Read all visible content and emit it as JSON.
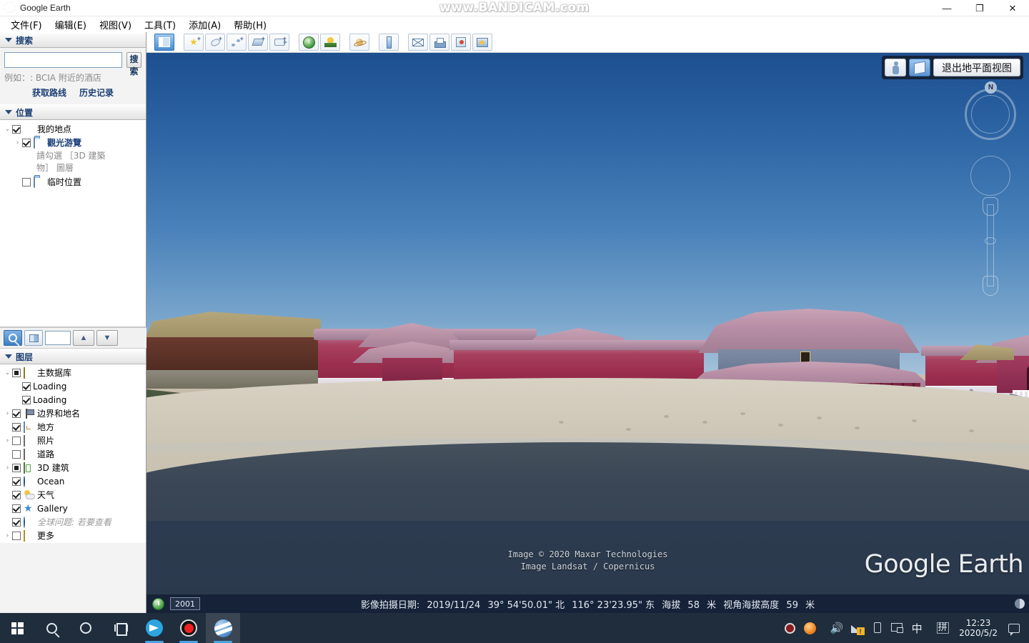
{
  "window": {
    "app_icon": "google-earth-globe-icon",
    "title": "Google Earth",
    "watermark": "www.BANDICAM.com",
    "minimize": "—",
    "maximize": "❐",
    "close": "✕"
  },
  "menubar": [
    {
      "label": "文件(F)",
      "name": "menu-file"
    },
    {
      "label": "编辑(E)",
      "name": "menu-edit"
    },
    {
      "label": "视图(V)",
      "name": "menu-view"
    },
    {
      "label": "工具(T)",
      "name": "menu-tools"
    },
    {
      "label": "添加(A)",
      "name": "menu-add"
    },
    {
      "label": "帮助(H)",
      "name": "menu-help"
    }
  ],
  "search_panel": {
    "header": "搜索",
    "input_value": "",
    "input_placeholder": "",
    "button": "搜索",
    "hint": "例如：: BCIA 附近的酒店",
    "links": [
      {
        "label": "获取路线",
        "name": "get-directions-link"
      },
      {
        "label": "历史记录",
        "name": "history-link"
      }
    ]
  },
  "places_panel": {
    "header": "位置",
    "items": [
      {
        "label": "我的地点",
        "checked": true,
        "icon": "globe-icon",
        "indent": 0,
        "expander": "v",
        "style": "normal"
      },
      {
        "label": "觀光游覽",
        "checked": true,
        "icon": "folder-icon",
        "indent": 1,
        "expander": ">",
        "style": "blue"
      },
      {
        "label": "請勾選 ［3D 建築物］ 圖層",
        "sub": true
      },
      {
        "label": "临时位置",
        "checked": false,
        "icon": "folder-icon",
        "indent": 0,
        "expander": "",
        "style": "normal"
      }
    ]
  },
  "places_toolstrip": {
    "search_icon": "magnifier-icon",
    "view_icon": "split-view-icon",
    "field_value": "",
    "up": "▲",
    "down": "▼"
  },
  "layers_panel": {
    "header": "图层",
    "items": [
      {
        "label": "主数据库",
        "state": "partial",
        "icon": "database-icon",
        "indent": 0,
        "expander": "v",
        "style": "normal"
      },
      {
        "label": "Loading",
        "state": "checked",
        "icon": "none",
        "indent": 1,
        "expander": "",
        "style": "normal"
      },
      {
        "label": "Loading",
        "state": "checked",
        "icon": "none",
        "indent": 1,
        "expander": "",
        "style": "normal"
      },
      {
        "label": "边界和地名",
        "state": "checked",
        "icon": "flag-icon",
        "indent": 1,
        "expander": ">",
        "style": "normal"
      },
      {
        "label": "地方",
        "state": "checked",
        "icon": "place-icon",
        "indent": 1,
        "expander": "",
        "style": "normal"
      },
      {
        "label": "照片",
        "state": "unchecked",
        "icon": "photo-icon",
        "indent": 1,
        "expander": ">",
        "style": "normal"
      },
      {
        "label": "道路",
        "state": "unchecked",
        "icon": "road-icon",
        "indent": 1,
        "expander": "",
        "style": "normal"
      },
      {
        "label": "3D 建筑",
        "state": "partial",
        "icon": "3d-building-icon",
        "indent": 1,
        "expander": ">",
        "style": "normal"
      },
      {
        "label": "Ocean",
        "state": "checked",
        "icon": "ocean-icon",
        "indent": 1,
        "expander": "",
        "style": "normal"
      },
      {
        "label": "天气",
        "state": "checked",
        "icon": "weather-icon",
        "indent": 1,
        "expander": "",
        "style": "normal"
      },
      {
        "label": "Gallery",
        "state": "checked",
        "icon": "star-icon",
        "indent": 1,
        "expander": "",
        "style": "normal"
      },
      {
        "label": "全球问题: 若要查看",
        "state": "checked",
        "icon": "earth-icon",
        "indent": 1,
        "expander": "",
        "style": "gray"
      },
      {
        "label": "更多",
        "state": "unchecked",
        "icon": "more-icon",
        "indent": 1,
        "expander": ">",
        "style": "normal"
      }
    ]
  },
  "toolbar": [
    {
      "name": "toggle-sidebar-button",
      "icon": "sidebar-panel-icon",
      "selected": true
    },
    {
      "name": "add-placemark-button",
      "icon": "placemark-pin-icon",
      "badge": "+"
    },
    {
      "name": "add-polygon-button",
      "icon": "polygon-icon",
      "badge": "+"
    },
    {
      "name": "add-path-button",
      "icon": "path-icon",
      "badge": "+"
    },
    {
      "name": "add-image-overlay-button",
      "icon": "image-overlay-icon",
      "badge": "+"
    },
    {
      "name": "record-tour-button",
      "icon": "movie-camera-icon",
      "badge": "+"
    },
    {
      "name": "historical-imagery-button",
      "icon": "clock-globe-icon"
    },
    {
      "name": "sunlight-button",
      "icon": "sun-landscape-icon"
    },
    {
      "name": "switch-sky-button",
      "icon": "planet-icon"
    },
    {
      "name": "measure-button",
      "icon": "ruler-icon"
    },
    {
      "name": "email-button",
      "icon": "envelope-icon"
    },
    {
      "name": "print-button",
      "icon": "printer-icon"
    },
    {
      "name": "save-image-button",
      "icon": "save-image-icon"
    },
    {
      "name": "view-in-maps-button",
      "icon": "map-icon"
    }
  ],
  "viewport": {
    "exit_ground_view_button": "退出地平面视图",
    "pegman_icon": "pegman-icon",
    "building_3d_icon": "3d-cube-icon",
    "compass_north": "N",
    "copyright_line1": "Image © 2020 Maxar Technologies",
    "copyright_line2": "Image Landsat / Copernicus",
    "logo": "Google Earth"
  },
  "statusbar": {
    "history_icon": "history-clock-icon",
    "year": "2001",
    "imagery_date_label": "影像拍摄日期:",
    "imagery_date": "2019/11/24",
    "latitude": "39° 54'50.01\" 北",
    "longitude": "116° 23'23.95\" 东",
    "elevation_label": "海拔",
    "elevation_value": "58",
    "elevation_unit": "米",
    "eye_alt_label": "视角海拔高度",
    "eye_alt_value": "59",
    "eye_alt_unit": "米"
  },
  "taskbar": {
    "items": [
      {
        "name": "start-button",
        "icon": "windows-logo-icon"
      },
      {
        "name": "search-taskbar-button",
        "icon": "magnifier-icon"
      },
      {
        "name": "cortana-button",
        "icon": "circle-icon"
      },
      {
        "name": "task-view-button",
        "icon": "task-view-icon"
      },
      {
        "name": "telegram-taskbar-button",
        "icon": "telegram-icon"
      },
      {
        "name": "bandicam-taskbar-button",
        "icon": "record-icon"
      },
      {
        "name": "google-earth-taskbar-button",
        "icon": "google-earth-globe-icon"
      }
    ],
    "tray": [
      {
        "name": "tray-bandicam-icon",
        "icon": "record-icon"
      },
      {
        "name": "tray-firefox-icon",
        "icon": "firefox-icon"
      },
      {
        "name": "tray-volume-icon",
        "icon": "speaker-icon"
      },
      {
        "name": "tray-network-icon",
        "icon": "network-warning-icon"
      },
      {
        "name": "tray-usb-icon",
        "icon": "usb-eject-icon"
      },
      {
        "name": "tray-display-icon",
        "icon": "display-icon"
      },
      {
        "name": "tray-ime-mode",
        "icon": "ime-chinese-icon",
        "label": "中"
      },
      {
        "name": "tray-ime-pinyin",
        "icon": "ime-pinyin-icon",
        "label": "拼"
      }
    ],
    "clock_time": "12:23",
    "clock_date": "2020/5/2",
    "notification_icon": "notification-icon"
  }
}
